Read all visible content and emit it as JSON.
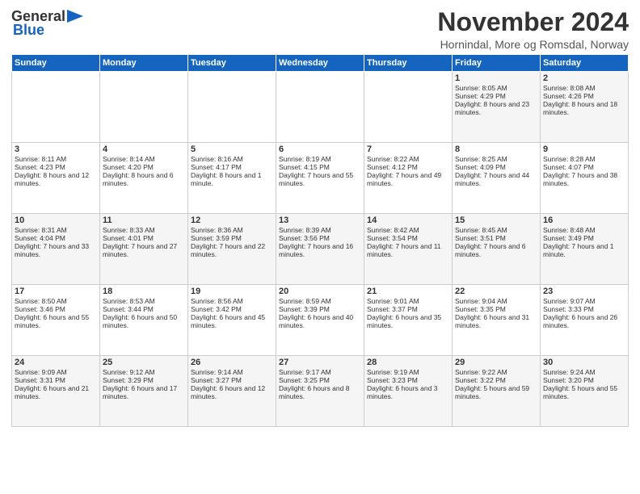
{
  "logo": {
    "general": "General",
    "blue": "Blue"
  },
  "header": {
    "title": "November 2024",
    "location": "Hornindal, More og Romsdal, Norway"
  },
  "columns": [
    "Sunday",
    "Monday",
    "Tuesday",
    "Wednesday",
    "Thursday",
    "Friday",
    "Saturday"
  ],
  "weeks": [
    [
      {
        "day": "",
        "sunrise": "",
        "sunset": "",
        "daylight": ""
      },
      {
        "day": "",
        "sunrise": "",
        "sunset": "",
        "daylight": ""
      },
      {
        "day": "",
        "sunrise": "",
        "sunset": "",
        "daylight": ""
      },
      {
        "day": "",
        "sunrise": "",
        "sunset": "",
        "daylight": ""
      },
      {
        "day": "",
        "sunrise": "",
        "sunset": "",
        "daylight": ""
      },
      {
        "day": "1",
        "sunrise": "Sunrise: 8:05 AM",
        "sunset": "Sunset: 4:29 PM",
        "daylight": "Daylight: 8 hours and 23 minutes."
      },
      {
        "day": "2",
        "sunrise": "Sunrise: 8:08 AM",
        "sunset": "Sunset: 4:26 PM",
        "daylight": "Daylight: 8 hours and 18 minutes."
      }
    ],
    [
      {
        "day": "3",
        "sunrise": "Sunrise: 8:11 AM",
        "sunset": "Sunset: 4:23 PM",
        "daylight": "Daylight: 8 hours and 12 minutes."
      },
      {
        "day": "4",
        "sunrise": "Sunrise: 8:14 AM",
        "sunset": "Sunset: 4:20 PM",
        "daylight": "Daylight: 8 hours and 6 minutes."
      },
      {
        "day": "5",
        "sunrise": "Sunrise: 8:16 AM",
        "sunset": "Sunset: 4:17 PM",
        "daylight": "Daylight: 8 hours and 1 minute."
      },
      {
        "day": "6",
        "sunrise": "Sunrise: 8:19 AM",
        "sunset": "Sunset: 4:15 PM",
        "daylight": "Daylight: 7 hours and 55 minutes."
      },
      {
        "day": "7",
        "sunrise": "Sunrise: 8:22 AM",
        "sunset": "Sunset: 4:12 PM",
        "daylight": "Daylight: 7 hours and 49 minutes."
      },
      {
        "day": "8",
        "sunrise": "Sunrise: 8:25 AM",
        "sunset": "Sunset: 4:09 PM",
        "daylight": "Daylight: 7 hours and 44 minutes."
      },
      {
        "day": "9",
        "sunrise": "Sunrise: 8:28 AM",
        "sunset": "Sunset: 4:07 PM",
        "daylight": "Daylight: 7 hours and 38 minutes."
      }
    ],
    [
      {
        "day": "10",
        "sunrise": "Sunrise: 8:31 AM",
        "sunset": "Sunset: 4:04 PM",
        "daylight": "Daylight: 7 hours and 33 minutes."
      },
      {
        "day": "11",
        "sunrise": "Sunrise: 8:33 AM",
        "sunset": "Sunset: 4:01 PM",
        "daylight": "Daylight: 7 hours and 27 minutes."
      },
      {
        "day": "12",
        "sunrise": "Sunrise: 8:36 AM",
        "sunset": "Sunset: 3:59 PM",
        "daylight": "Daylight: 7 hours and 22 minutes."
      },
      {
        "day": "13",
        "sunrise": "Sunrise: 8:39 AM",
        "sunset": "Sunset: 3:56 PM",
        "daylight": "Daylight: 7 hours and 16 minutes."
      },
      {
        "day": "14",
        "sunrise": "Sunrise: 8:42 AM",
        "sunset": "Sunset: 3:54 PM",
        "daylight": "Daylight: 7 hours and 11 minutes."
      },
      {
        "day": "15",
        "sunrise": "Sunrise: 8:45 AM",
        "sunset": "Sunset: 3:51 PM",
        "daylight": "Daylight: 7 hours and 6 minutes."
      },
      {
        "day": "16",
        "sunrise": "Sunrise: 8:48 AM",
        "sunset": "Sunset: 3:49 PM",
        "daylight": "Daylight: 7 hours and 1 minute."
      }
    ],
    [
      {
        "day": "17",
        "sunrise": "Sunrise: 8:50 AM",
        "sunset": "Sunset: 3:46 PM",
        "daylight": "Daylight: 6 hours and 55 minutes."
      },
      {
        "day": "18",
        "sunrise": "Sunrise: 8:53 AM",
        "sunset": "Sunset: 3:44 PM",
        "daylight": "Daylight: 6 hours and 50 minutes."
      },
      {
        "day": "19",
        "sunrise": "Sunrise: 8:56 AM",
        "sunset": "Sunset: 3:42 PM",
        "daylight": "Daylight: 6 hours and 45 minutes."
      },
      {
        "day": "20",
        "sunrise": "Sunrise: 8:59 AM",
        "sunset": "Sunset: 3:39 PM",
        "daylight": "Daylight: 6 hours and 40 minutes."
      },
      {
        "day": "21",
        "sunrise": "Sunrise: 9:01 AM",
        "sunset": "Sunset: 3:37 PM",
        "daylight": "Daylight: 6 hours and 35 minutes."
      },
      {
        "day": "22",
        "sunrise": "Sunrise: 9:04 AM",
        "sunset": "Sunset: 3:35 PM",
        "daylight": "Daylight: 6 hours and 31 minutes."
      },
      {
        "day": "23",
        "sunrise": "Sunrise: 9:07 AM",
        "sunset": "Sunset: 3:33 PM",
        "daylight": "Daylight: 6 hours and 26 minutes."
      }
    ],
    [
      {
        "day": "24",
        "sunrise": "Sunrise: 9:09 AM",
        "sunset": "Sunset: 3:31 PM",
        "daylight": "Daylight: 6 hours and 21 minutes."
      },
      {
        "day": "25",
        "sunrise": "Sunrise: 9:12 AM",
        "sunset": "Sunset: 3:29 PM",
        "daylight": "Daylight: 6 hours and 17 minutes."
      },
      {
        "day": "26",
        "sunrise": "Sunrise: 9:14 AM",
        "sunset": "Sunset: 3:27 PM",
        "daylight": "Daylight: 6 hours and 12 minutes."
      },
      {
        "day": "27",
        "sunrise": "Sunrise: 9:17 AM",
        "sunset": "Sunset: 3:25 PM",
        "daylight": "Daylight: 6 hours and 8 minutes."
      },
      {
        "day": "28",
        "sunrise": "Sunrise: 9:19 AM",
        "sunset": "Sunset: 3:23 PM",
        "daylight": "Daylight: 6 hours and 3 minutes."
      },
      {
        "day": "29",
        "sunrise": "Sunrise: 9:22 AM",
        "sunset": "Sunset: 3:22 PM",
        "daylight": "Daylight: 5 hours and 59 minutes."
      },
      {
        "day": "30",
        "sunrise": "Sunrise: 9:24 AM",
        "sunset": "Sunset: 3:20 PM",
        "daylight": "Daylight: 5 hours and 55 minutes."
      }
    ]
  ]
}
